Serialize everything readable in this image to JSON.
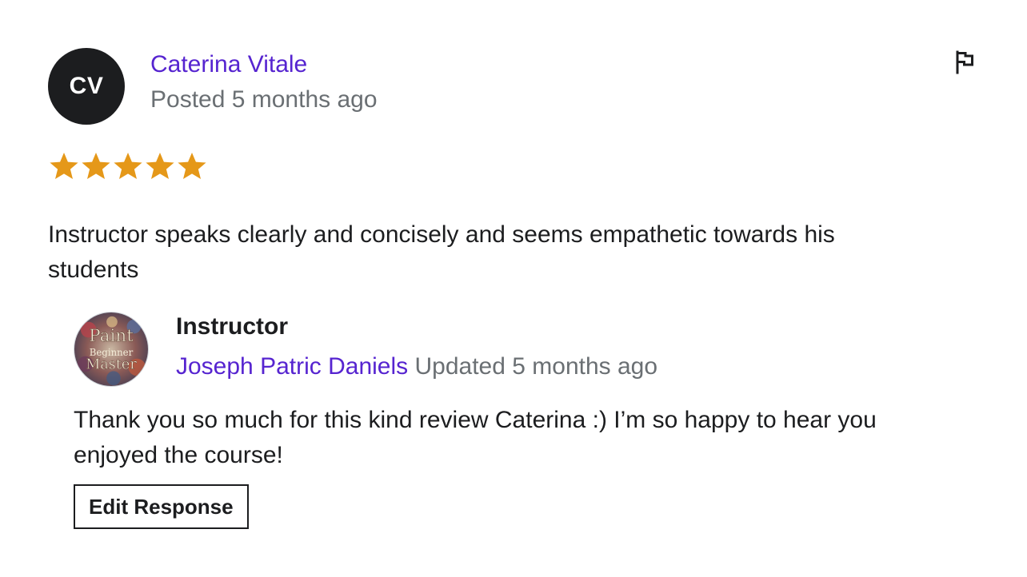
{
  "review": {
    "avatar_initials": "CV",
    "reviewer_name": "Caterina Vitale",
    "posted": "Posted 5 months ago",
    "rating": 5,
    "rating_max": 5,
    "star_color": "#e59819",
    "text": "Instructor speaks clearly and concisely and seems empathetic towards his students",
    "report_icon": "flag-icon"
  },
  "response": {
    "label": "Instructor",
    "instructor_name": "Joseph Patric Daniels",
    "updated": "Updated 5 months ago",
    "avatar_logo_text": [
      "Paint",
      "Beginner",
      "Master"
    ],
    "text": "Thank you so much for this kind review Caterina :) I’m so happy to hear you enjoyed the course!",
    "edit_button_label": "Edit Response"
  },
  "colors": {
    "link": "#5624d0",
    "muted": "#6a6f73",
    "text": "#1c1d1f"
  }
}
